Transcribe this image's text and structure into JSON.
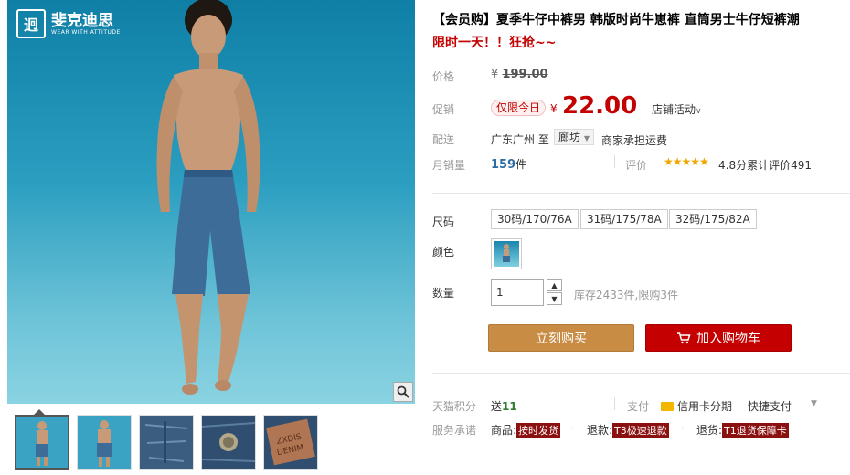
{
  "brand": {
    "name": "斐克迪思",
    "slogan": "WEAR WITH ATTITUDE",
    "mark": "迥"
  },
  "product": {
    "title": "【会员购】夏季牛仔中裤男 韩版时尚牛崽裤 直筒男士牛仔短裤潮",
    "subtitle": "限时一天！！狂抢~~"
  },
  "price": {
    "label": "价格",
    "currency": "¥",
    "original": "199.00"
  },
  "promo": {
    "label": "促销",
    "badge": "仅限今日",
    "currency": "¥",
    "price": "22.00",
    "store_activity": "店铺活动"
  },
  "shipping": {
    "label": "配送",
    "from": "广东广州 至",
    "dest": "廊坊",
    "note": "商家承担运费"
  },
  "sales": {
    "label": "月销量",
    "count": "159",
    "unit": "件",
    "rating_label": "评价",
    "stars": "★★★★★",
    "rating_text": "4.8分累计评价491"
  },
  "size": {
    "label": "尺码",
    "options": [
      "30码/170/76A",
      "31码/175/78A",
      "32码/175/82A"
    ]
  },
  "color": {
    "label": "颜色"
  },
  "quantity": {
    "label": "数量",
    "value": "1",
    "stock": "库存2433件,限购3件"
  },
  "actions": {
    "buy_now": "立刻购买",
    "add_to_cart": "加入购物车"
  },
  "points": {
    "label": "天猫积分",
    "prefix": "送",
    "value": "11"
  },
  "payment": {
    "label": "支付",
    "credit": "信用卡分期",
    "quick": "快捷支付"
  },
  "service": {
    "label": "服务承诺",
    "items": [
      {
        "prefix": "商品:",
        "tag": "按时发货"
      },
      {
        "prefix": "退款:",
        "tag": "T3极速退款"
      },
      {
        "prefix": "退货:",
        "tag": "T1退货保障卡"
      }
    ]
  },
  "colors": {
    "accent_red": "#c40000",
    "buy_button": "#c88c44",
    "sky": "#2b9ec0"
  },
  "icons": [
    "zoom-icon",
    "chevron-down-icon",
    "cart-icon",
    "credit-card-icon",
    "star-icon"
  ]
}
